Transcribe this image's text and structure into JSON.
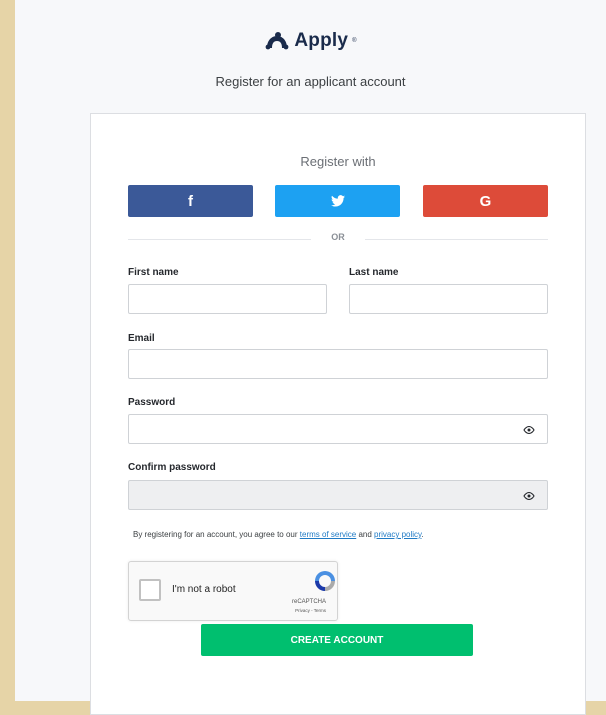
{
  "brand": {
    "name": "Apply"
  },
  "subtitle": "Register for an applicant account",
  "register_with": "Register with",
  "social": [
    {
      "name": "facebook",
      "glyph": "f",
      "color": "#3b5998"
    },
    {
      "name": "twitter",
      "glyph": "twitter-bird",
      "color": "#1da1f2"
    },
    {
      "name": "google",
      "glyph": "G",
      "color": "#dd4b39"
    }
  ],
  "or_text": "OR",
  "form": {
    "first_name_label": "First name",
    "last_name_label": "Last name",
    "email_label": "Email",
    "password_label": "Password",
    "confirm_password_label": "Confirm password",
    "first_name_value": "",
    "last_name_value": "",
    "email_value": "",
    "password_value": "",
    "confirm_password_value": ""
  },
  "terms": {
    "prefix": "By registering for an account, you agree to our ",
    "tos_link": "terms of service",
    "middle": " and ",
    "privacy_link": "privacy policy",
    "suffix": "."
  },
  "captcha": {
    "label": "I'm not a robot",
    "brand": "reCAPTCHA",
    "links": "Privacy - Terms"
  },
  "create_account": "CREATE ACCOUNT",
  "colors": {
    "accent": "#00bf6f",
    "background": "#e6d4a7"
  }
}
